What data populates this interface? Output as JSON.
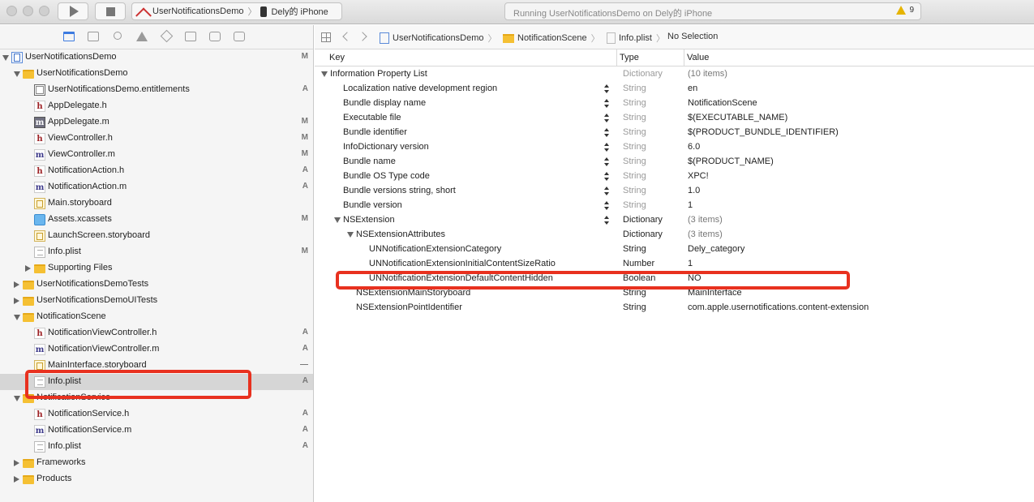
{
  "toolbar": {
    "scheme_name": "UserNotificationsDemo",
    "device_name": "Dely的 iPhone",
    "activity_text": "Running UserNotificationsDemo on Dely的 iPhone",
    "warning_count": "9"
  },
  "navigator": {
    "tabs": [
      "folder-icon",
      "hierarchy-icon",
      "search-icon",
      "warning-icon",
      "test-diamond-icon",
      "debug-icon",
      "breakpoint-icon",
      "report-bubble-icon"
    ],
    "items": [
      {
        "label": "UserNotificationsDemo",
        "icon": "project-icon",
        "status": "M",
        "depth": 0,
        "disclosure": "open"
      },
      {
        "label": "UserNotificationsDemo",
        "icon": "folder-icon",
        "status": "",
        "depth": 1,
        "disclosure": "open"
      },
      {
        "label": "UserNotificationsDemo.entitlements",
        "icon": "entitlements-file-icon",
        "status": "A",
        "depth": 2,
        "disclosure": ""
      },
      {
        "label": "AppDelegate.h",
        "icon": "header-file-icon",
        "status": "",
        "depth": 2,
        "disclosure": ""
      },
      {
        "label": "AppDelegate.m",
        "icon": "objc-file-icon",
        "status": "M",
        "depth": 2,
        "disclosure": ""
      },
      {
        "label": "ViewController.h",
        "icon": "header-file-icon",
        "status": "M",
        "depth": 2,
        "disclosure": ""
      },
      {
        "label": "ViewController.m",
        "icon": "objc-file-icon",
        "status": "M",
        "depth": 2,
        "disclosure": ""
      },
      {
        "label": "NotificationAction.h",
        "icon": "header-file-icon",
        "status": "A",
        "depth": 2,
        "disclosure": ""
      },
      {
        "label": "NotificationAction.m",
        "icon": "objc-file-icon",
        "status": "A",
        "depth": 2,
        "disclosure": ""
      },
      {
        "label": "Main.storyboard",
        "icon": "storyboard-file-icon",
        "status": "",
        "depth": 2,
        "disclosure": ""
      },
      {
        "label": "Assets.xcassets",
        "icon": "assets-catalog-icon",
        "status": "M",
        "depth": 2,
        "disclosure": ""
      },
      {
        "label": "LaunchScreen.storyboard",
        "icon": "storyboard-file-icon",
        "status": "",
        "depth": 2,
        "disclosure": ""
      },
      {
        "label": "Info.plist",
        "icon": "plist-file-icon",
        "status": "M",
        "depth": 2,
        "disclosure": ""
      },
      {
        "label": "Supporting Files",
        "icon": "folder-icon",
        "status": "",
        "depth": 2,
        "disclosure": "closed"
      },
      {
        "label": "UserNotificationsDemoTests",
        "icon": "folder-icon",
        "status": "",
        "depth": 1,
        "disclosure": "closed"
      },
      {
        "label": "UserNotificationsDemoUITests",
        "icon": "folder-icon",
        "status": "",
        "depth": 1,
        "disclosure": "closed"
      },
      {
        "label": "NotificationScene",
        "icon": "folder-icon",
        "status": "",
        "depth": 1,
        "disclosure": "open"
      },
      {
        "label": "NotificationViewController.h",
        "icon": "header-file-icon",
        "status": "A",
        "depth": 2,
        "disclosure": ""
      },
      {
        "label": "NotificationViewController.m",
        "icon": "objc-file-icon",
        "status": "A",
        "depth": 2,
        "disclosure": ""
      },
      {
        "label": "MainInterface.storyboard",
        "icon": "storyboard-file-icon",
        "status": "—",
        "depth": 2,
        "disclosure": ""
      },
      {
        "label": "Info.plist",
        "icon": "plist-file-icon",
        "status": "A",
        "depth": 2,
        "disclosure": "",
        "selected": true
      },
      {
        "label": "NotificationService",
        "icon": "folder-icon",
        "status": "",
        "depth": 1,
        "disclosure": "open"
      },
      {
        "label": "NotificationService.h",
        "icon": "header-file-icon",
        "status": "A",
        "depth": 2,
        "disclosure": ""
      },
      {
        "label": "NotificationService.m",
        "icon": "objc-file-icon",
        "status": "A",
        "depth": 2,
        "disclosure": ""
      },
      {
        "label": "Info.plist",
        "icon": "plist-file-icon",
        "status": "A",
        "depth": 2,
        "disclosure": ""
      },
      {
        "label": "Frameworks",
        "icon": "folder-icon",
        "status": "",
        "depth": 1,
        "disclosure": "closed"
      },
      {
        "label": "Products",
        "icon": "folder-icon",
        "status": "",
        "depth": 1,
        "disclosure": "closed"
      }
    ]
  },
  "jumpbar": {
    "crumbs": [
      "UserNotificationsDemo",
      "NotificationScene",
      "Info.plist",
      "No Selection"
    ]
  },
  "plist": {
    "columns": {
      "key": "Key",
      "type": "Type",
      "value": "Value"
    },
    "rows": [
      {
        "key": "Information Property List",
        "type": "Dictionary",
        "value": "(10 items)",
        "depth": 0,
        "open": true,
        "stepper": false,
        "type_dark": false,
        "value_gray": true
      },
      {
        "key": "Localization native development region",
        "type": "String",
        "value": "en",
        "depth": 1,
        "open": false,
        "stepper": true,
        "type_dark": false,
        "value_gray": false
      },
      {
        "key": "Bundle display name",
        "type": "String",
        "value": "NotificationScene",
        "depth": 1,
        "open": false,
        "stepper": true,
        "type_dark": false,
        "value_gray": false
      },
      {
        "key": "Executable file",
        "type": "String",
        "value": "$(EXECUTABLE_NAME)",
        "depth": 1,
        "open": false,
        "stepper": true,
        "type_dark": false,
        "value_gray": false
      },
      {
        "key": "Bundle identifier",
        "type": "String",
        "value": "$(PRODUCT_BUNDLE_IDENTIFIER)",
        "depth": 1,
        "open": false,
        "stepper": true,
        "type_dark": false,
        "value_gray": false
      },
      {
        "key": "InfoDictionary version",
        "type": "String",
        "value": "6.0",
        "depth": 1,
        "open": false,
        "stepper": true,
        "type_dark": false,
        "value_gray": false
      },
      {
        "key": "Bundle name",
        "type": "String",
        "value": "$(PRODUCT_NAME)",
        "depth": 1,
        "open": false,
        "stepper": true,
        "type_dark": false,
        "value_gray": false
      },
      {
        "key": "Bundle OS Type code",
        "type": "String",
        "value": "XPC!",
        "depth": 1,
        "open": false,
        "stepper": true,
        "type_dark": false,
        "value_gray": false
      },
      {
        "key": "Bundle versions string, short",
        "type": "String",
        "value": "1.0",
        "depth": 1,
        "open": false,
        "stepper": true,
        "type_dark": false,
        "value_gray": false
      },
      {
        "key": "Bundle version",
        "type": "String",
        "value": "1",
        "depth": 1,
        "open": false,
        "stepper": true,
        "type_dark": false,
        "value_gray": false
      },
      {
        "key": "NSExtension",
        "type": "Dictionary",
        "value": "(3 items)",
        "depth": 1,
        "open": true,
        "stepper": true,
        "type_dark": true,
        "value_gray": true
      },
      {
        "key": "NSExtensionAttributes",
        "type": "Dictionary",
        "value": "(3 items)",
        "depth": 2,
        "open": true,
        "stepper": false,
        "type_dark": true,
        "value_gray": true
      },
      {
        "key": "UNNotificationExtensionCategory",
        "type": "String",
        "value": "Dely_category",
        "depth": 3,
        "open": false,
        "stepper": false,
        "type_dark": true,
        "value_gray": false
      },
      {
        "key": "UNNotificationExtensionInitialContentSizeRatio",
        "type": "Number",
        "value": "1",
        "depth": 3,
        "open": false,
        "stepper": false,
        "type_dark": true,
        "value_gray": false
      },
      {
        "key": "UNNotificationExtensionDefaultContentHidden",
        "type": "Boolean",
        "value": "NO",
        "depth": 3,
        "open": false,
        "stepper": false,
        "type_dark": true,
        "value_gray": false
      },
      {
        "key": "NSExtensionMainStoryboard",
        "type": "String",
        "value": "MainInterface",
        "depth": 2,
        "open": false,
        "stepper": false,
        "type_dark": true,
        "value_gray": false
      },
      {
        "key": "NSExtensionPointIdentifier",
        "type": "String",
        "value": "com.apple.usernotifications.content-extension",
        "depth": 2,
        "open": false,
        "stepper": false,
        "type_dark": true,
        "value_gray": false
      }
    ]
  },
  "colors": {
    "annotation_red": "#e8311f",
    "selection_gray": "#d6d6d6",
    "folder_yellow": "#f5c033"
  }
}
